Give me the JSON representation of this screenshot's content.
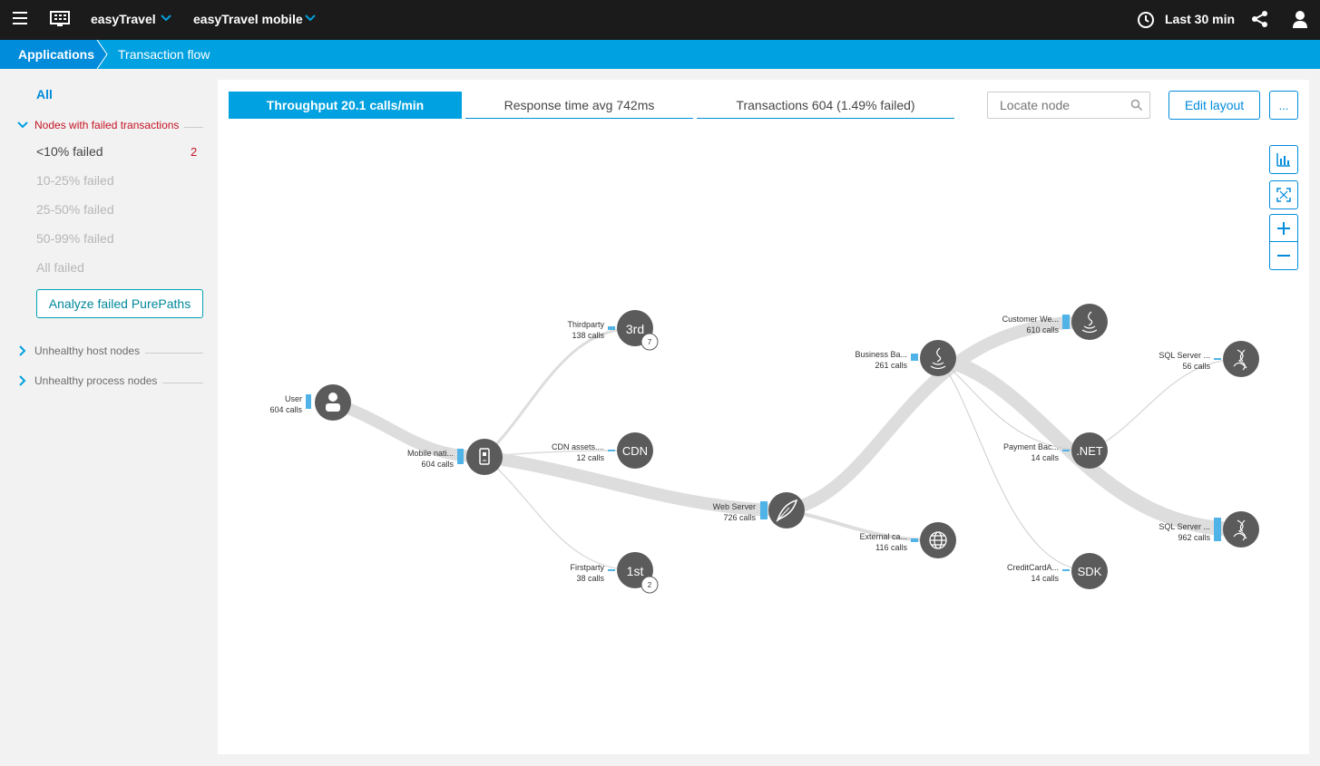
{
  "topbar": {
    "environment": "easyTravel",
    "application": "easyTravel mobile",
    "timeframe": "Last 30 min",
    "icons": [
      "menu-icon",
      "apps-icon",
      "chevron-down-icon",
      "clock-icon",
      "share-icon",
      "user-icon"
    ]
  },
  "breadcrumb": {
    "items": [
      "Applications",
      "Transaction flow"
    ]
  },
  "sidebar": {
    "all_label": "All",
    "failed_section": "Nodes with failed transactions",
    "filters": [
      {
        "label": "<10% failed",
        "count": "2"
      },
      {
        "label": "10-25% failed"
      },
      {
        "label": "25-50% failed"
      },
      {
        "label": "50-99% failed"
      },
      {
        "label": "All failed"
      }
    ],
    "analyze_button": "Analyze failed PurePaths",
    "unhealthy_host": "Unhealthy host nodes",
    "unhealthy_process": "Unhealthy process nodes"
  },
  "tabs": [
    {
      "label": "Throughput 20.1 calls/min",
      "active": true
    },
    {
      "label": "Response time avg 742ms"
    },
    {
      "label": "Transactions 604 (1.49% failed)"
    }
  ],
  "toolbar": {
    "locate_placeholder": "Locate node",
    "edit_layout": "Edit layout",
    "more": "...",
    "zoom_in": "+",
    "zoom_out": "−"
  },
  "colors": {
    "accent": "#00a1e0",
    "accent_dark": "#008cdb",
    "failed": "#c41425",
    "node": "#5b5b5b",
    "flow": "#dddddd",
    "bar": "#4fb3e8"
  },
  "graph": {
    "nodes": [
      {
        "id": "user",
        "label": "User",
        "calls": "604 calls",
        "icon": "user-icon"
      },
      {
        "id": "mobile",
        "label": "Mobile nati...",
        "calls": "604 calls",
        "icon": "mobile-icon"
      },
      {
        "id": "thirdparty",
        "label": "Thirdparty",
        "calls": "138 calls",
        "glyph": "3rd",
        "badge": "7"
      },
      {
        "id": "cdn",
        "label": "CDN assets....",
        "calls": "12 calls",
        "glyph": "CDN"
      },
      {
        "id": "firstparty",
        "label": "Firstparty",
        "calls": "38 calls",
        "glyph": "1st",
        "badge": "2"
      },
      {
        "id": "webserver",
        "label": "Web Server",
        "calls": "726 calls",
        "icon": "feather-icon"
      },
      {
        "id": "external",
        "label": "External ca...",
        "calls": "116 calls",
        "icon": "globe-icon"
      },
      {
        "id": "business",
        "label": "Business Ba...",
        "calls": "261 calls",
        "icon": "java-icon"
      },
      {
        "id": "customer",
        "label": "Customer We...",
        "calls": "610 calls",
        "icon": "java-icon"
      },
      {
        "id": "payment",
        "label": "Payment Bac...",
        "calls": "14 calls",
        "glyph": ".NET"
      },
      {
        "id": "creditcard",
        "label": "CreditCardA...",
        "calls": "14 calls",
        "glyph": "SDK"
      },
      {
        "id": "sql1",
        "label": "SQL Server ...",
        "calls": "56 calls",
        "icon": "sql-server-icon"
      },
      {
        "id": "sql2",
        "label": "SQL Server ...",
        "calls": "962 calls",
        "icon": "sql-server-icon"
      }
    ]
  }
}
